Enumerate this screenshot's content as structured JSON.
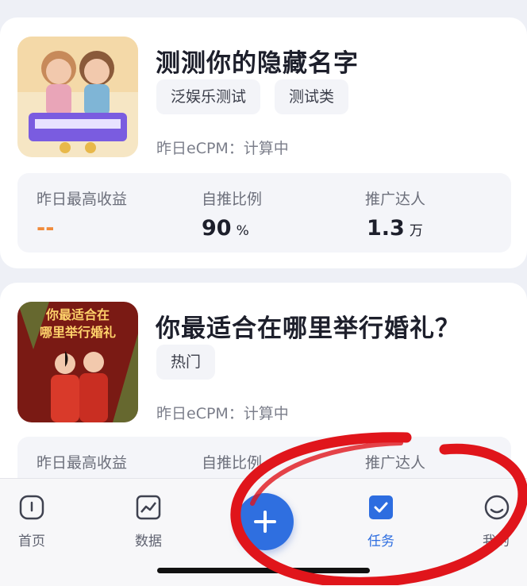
{
  "cards": [
    {
      "title": "测测你的隐藏名字",
      "tags": [
        "泛娱乐测试",
        "测试类"
      ],
      "ecpm": "昨日eCPM：计算中",
      "stats": [
        {
          "label": "昨日最高收益",
          "value": "--",
          "unit": ""
        },
        {
          "label": "自推比例",
          "value": "90",
          "unit": "%"
        },
        {
          "label": "推广达人",
          "value": "1.3",
          "unit": "万"
        }
      ]
    },
    {
      "title": "你最适合在哪里举行婚礼？",
      "thumb_text": [
        "你最适合在",
        "哪里举行婚礼"
      ],
      "tags": [
        "热门"
      ],
      "ecpm": "昨日eCPM：计算中",
      "stats": [
        {
          "label": "昨日最高收益"
        },
        {
          "label": "自推比例"
        },
        {
          "label": "推广达人"
        }
      ]
    }
  ],
  "tabbar": {
    "items": [
      {
        "label": "首页",
        "icon": "home-icon"
      },
      {
        "label": "数据",
        "icon": "chart-icon"
      },
      {
        "label": "",
        "icon": "plus-icon"
      },
      {
        "label": "任务",
        "icon": "task-check-icon",
        "active": true
      },
      {
        "label": "我的",
        "icon": "profile-icon"
      }
    ]
  },
  "colors": {
    "accent": "#2f6fe0",
    "dash": "#f08a3a",
    "annotation": "#e0151b"
  }
}
